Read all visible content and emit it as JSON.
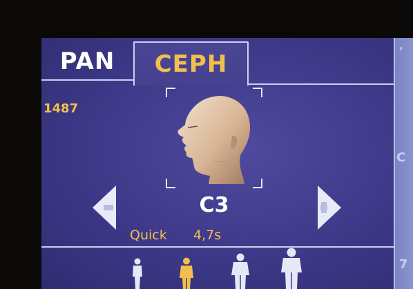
{
  "tabs": [
    {
      "label": "PAN",
      "selected": false
    },
    {
      "label": "CEPH",
      "selected": true
    }
  ],
  "counter": "1487",
  "program": {
    "code": "C3",
    "mode": "Quick",
    "time": "4,7s"
  },
  "patient_sizes": [
    {
      "icon": "child-small-icon",
      "selected": false
    },
    {
      "icon": "child-icon",
      "selected": true
    },
    {
      "icon": "adult-medium-icon",
      "selected": false
    },
    {
      "icon": "adult-large-icon",
      "selected": false
    }
  ],
  "colors": {
    "accent_yellow": "#f1c04c",
    "background_blue": "#3f3a8a",
    "line_color": "#c9d2f0",
    "text_white": "#ffffff"
  }
}
